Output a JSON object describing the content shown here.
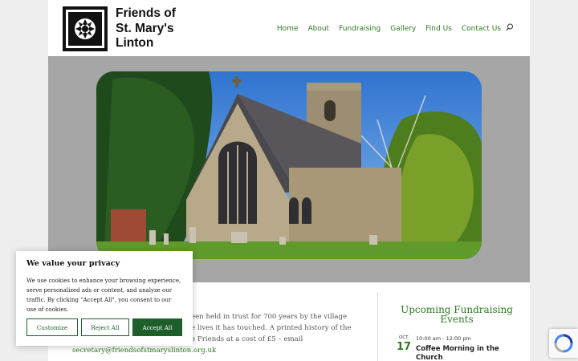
{
  "site": {
    "brand_lines": [
      "Friends of",
      "St. Mary's",
      "Linton"
    ]
  },
  "nav": {
    "items": [
      "Home",
      "About",
      "Fundraising",
      "Gallery",
      "Find Us",
      "Contact Us"
    ],
    "search_icon": "search-icon"
  },
  "colors": {
    "accent": "#2c7a1f",
    "cookie_button": "#1d5e2b",
    "hero_bg": "#a6a6a6"
  },
  "content": {
    "line1": "een held in trust for 700 years by the village",
    "line2": "e lives it has touched.  A printed history of the",
    "line3": "e Friends at a cost of £5 – email",
    "email": "secretary@friendsofstmaryslinton.org.uk"
  },
  "events": {
    "heading": "Upcoming Fundraising Events",
    "items": [
      {
        "month": "OCT",
        "day": "17",
        "time": "10:00 am - 12:00 pm",
        "title": "Coffee Morning in the Church"
      }
    ]
  },
  "cookie": {
    "title": "We value your privacy",
    "body": "We use cookies to enhance your browsing experience, serve personalized ads or content, and analyze our traffic. By clicking \"Accept All\", you consent to our use of cookies.",
    "customize": "Customize",
    "reject": "Reject All",
    "accept": "Accept All"
  }
}
